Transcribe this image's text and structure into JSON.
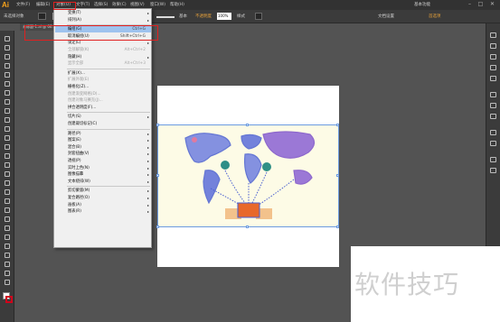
{
  "app": {
    "logo": "Ai",
    "workspace": "基本功能"
  },
  "menubar": {
    "items": [
      "文件(F)",
      "编辑(E)",
      "对象(O)",
      "文字(T)",
      "选择(S)",
      "效果(C)",
      "视图(V)",
      "窗口(W)",
      "帮助(H)"
    ]
  },
  "window_controls": {
    "minimize": "–",
    "maximize": "□",
    "close": "✕"
  },
  "control_bar": {
    "no_selection": "未选择对象",
    "stroke_style": "基本",
    "opacity_label": "不透明度",
    "opacity_value": "100%",
    "style_label": "样式",
    "doc_setup": "文档设置",
    "preferences": "首选项"
  },
  "doc_tab": {
    "title": "未标题-1.ai @ 66.67%"
  },
  "object_menu": {
    "items": [
      {
        "label": "变换(T)",
        "shortcut": "",
        "submenu": true,
        "disabled": false,
        "highlighted": false,
        "sep_after": false
      },
      {
        "label": "排列(A)",
        "shortcut": "",
        "submenu": true,
        "disabled": false,
        "highlighted": false,
        "sep_after": true
      },
      {
        "label": "编组(G)",
        "shortcut": "Ctrl+G",
        "submenu": false,
        "disabled": false,
        "highlighted": true,
        "sep_after": false
      },
      {
        "label": "取消编组(U)",
        "shortcut": "Shift+Ctrl+G",
        "submenu": false,
        "disabled": false,
        "highlighted": false,
        "sep_after": false
      },
      {
        "label": "锁定(L)",
        "shortcut": "",
        "submenu": true,
        "disabled": false,
        "highlighted": false,
        "sep_after": false
      },
      {
        "label": "全部解锁(K)",
        "shortcut": "Alt+Ctrl+2",
        "submenu": false,
        "disabled": true,
        "highlighted": false,
        "sep_after": false
      },
      {
        "label": "隐藏(H)",
        "shortcut": "",
        "submenu": true,
        "disabled": false,
        "highlighted": false,
        "sep_after": false
      },
      {
        "label": "显示全部",
        "shortcut": "Alt+Ctrl+3",
        "submenu": false,
        "disabled": true,
        "highlighted": false,
        "sep_after": true
      },
      {
        "label": "扩展(X)...",
        "shortcut": "",
        "submenu": false,
        "disabled": false,
        "highlighted": false,
        "sep_after": false
      },
      {
        "label": "扩展外观(E)",
        "shortcut": "",
        "submenu": false,
        "disabled": true,
        "highlighted": false,
        "sep_after": false
      },
      {
        "label": "栅格化(Z)...",
        "shortcut": "",
        "submenu": false,
        "disabled": false,
        "highlighted": false,
        "sep_after": false
      },
      {
        "label": "创建渐变网格(D)...",
        "shortcut": "",
        "submenu": false,
        "disabled": true,
        "highlighted": false,
        "sep_after": false
      },
      {
        "label": "创建对象马赛克(J)...",
        "shortcut": "",
        "submenu": false,
        "disabled": true,
        "highlighted": false,
        "sep_after": false
      },
      {
        "label": "拼合透明度(F)...",
        "shortcut": "",
        "submenu": false,
        "disabled": false,
        "highlighted": false,
        "sep_after": true
      },
      {
        "label": "切片(S)",
        "shortcut": "",
        "submenu": true,
        "disabled": false,
        "highlighted": false,
        "sep_after": false
      },
      {
        "label": "创建裁切标记(C)",
        "shortcut": "",
        "submenu": false,
        "disabled": false,
        "highlighted": false,
        "sep_after": true
      },
      {
        "label": "路径(P)",
        "shortcut": "",
        "submenu": true,
        "disabled": false,
        "highlighted": false,
        "sep_after": false
      },
      {
        "label": "图案(E)",
        "shortcut": "",
        "submenu": true,
        "disabled": false,
        "highlighted": false,
        "sep_after": false
      },
      {
        "label": "混合(B)",
        "shortcut": "",
        "submenu": true,
        "disabled": false,
        "highlighted": false,
        "sep_after": false
      },
      {
        "label": "封套扭曲(V)",
        "shortcut": "",
        "submenu": true,
        "disabled": false,
        "highlighted": false,
        "sep_after": false
      },
      {
        "label": "透视(P)",
        "shortcut": "",
        "submenu": true,
        "disabled": false,
        "highlighted": false,
        "sep_after": false
      },
      {
        "label": "实时上色(N)",
        "shortcut": "",
        "submenu": true,
        "disabled": false,
        "highlighted": false,
        "sep_after": false
      },
      {
        "label": "图像描摹",
        "shortcut": "",
        "submenu": true,
        "disabled": false,
        "highlighted": false,
        "sep_after": false
      },
      {
        "label": "文本绕排(W)",
        "shortcut": "",
        "submenu": true,
        "disabled": false,
        "highlighted": false,
        "sep_after": true
      },
      {
        "label": "剪切蒙版(M)",
        "shortcut": "",
        "submenu": true,
        "disabled": false,
        "highlighted": false,
        "sep_after": false
      },
      {
        "label": "复合路径(O)",
        "shortcut": "",
        "submenu": true,
        "disabled": false,
        "highlighted": false,
        "sep_after": false
      },
      {
        "label": "画板(A)",
        "shortcut": "",
        "submenu": true,
        "disabled": false,
        "highlighted": false,
        "sep_after": false
      },
      {
        "label": "图表(R)",
        "shortcut": "",
        "submenu": true,
        "disabled": false,
        "highlighted": false,
        "sep_after": false
      }
    ]
  },
  "watermark": {
    "text": "软件技巧"
  },
  "colors": {
    "highlight_box": "#e02020",
    "menu_highlight": "#9ec3ee",
    "map_blue": "#4a5fd0",
    "map_purple": "#7b4fc8",
    "map_teal": "#2f8f86",
    "device_orange": "#e8682a"
  }
}
